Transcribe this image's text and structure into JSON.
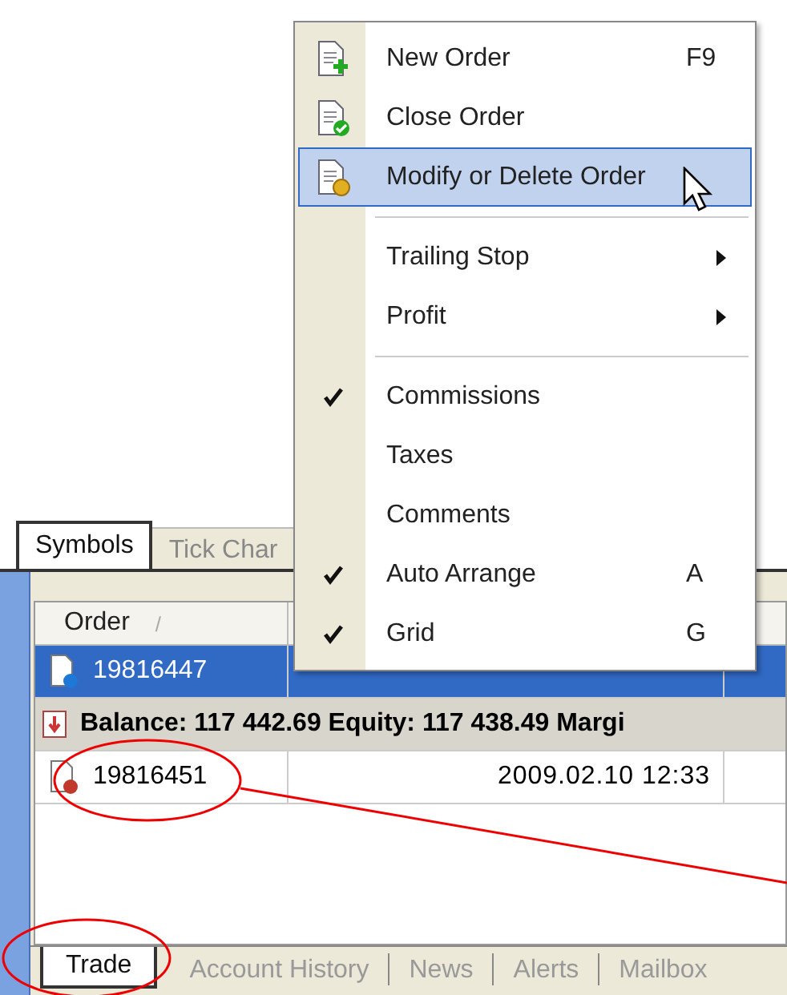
{
  "top_tabs": [
    {
      "label": "Symbols",
      "selected": true
    },
    {
      "label": "Tick Char",
      "selected": false
    }
  ],
  "table": {
    "column": "Order",
    "sort_mark": "/",
    "rows": [
      {
        "kind": "order",
        "order": "19816447",
        "selected": true,
        "color": "#1e78d6"
      },
      {
        "kind": "summary",
        "text": "Balance: 117 442.69  Equity: 117 438.49  Margi"
      },
      {
        "kind": "order",
        "order": "19816451",
        "time": "2009.02.10 12:33",
        "selected": false,
        "color": "#c0392b"
      }
    ]
  },
  "bottom_tabs": [
    {
      "label": "Trade",
      "selected": true
    },
    {
      "label": "Account History",
      "selected": false
    },
    {
      "label": "News",
      "selected": false
    },
    {
      "label": "Alerts",
      "selected": false
    },
    {
      "label": "Mailbox",
      "selected": false
    }
  ],
  "context_menu": {
    "items": [
      {
        "kind": "command",
        "label": "New Order",
        "shortcut": "F9",
        "selected": false
      },
      {
        "kind": "command",
        "label": "Close Order",
        "selected": false
      },
      {
        "kind": "command",
        "label": "Modify or Delete Order",
        "selected": true
      },
      {
        "kind": "separator"
      },
      {
        "kind": "submenu",
        "label": "Trailing Stop"
      },
      {
        "kind": "submenu",
        "label": "Profit"
      },
      {
        "kind": "separator"
      },
      {
        "kind": "toggle",
        "label": "Commissions",
        "checked": true
      },
      {
        "kind": "toggle",
        "label": "Taxes",
        "checked": false
      },
      {
        "kind": "toggle",
        "label": "Comments",
        "checked": false
      },
      {
        "kind": "toggle",
        "label": "Auto Arrange",
        "shortcut": "A",
        "checked": true
      },
      {
        "kind": "toggle",
        "label": "Grid",
        "shortcut": "G",
        "checked": true
      }
    ]
  }
}
